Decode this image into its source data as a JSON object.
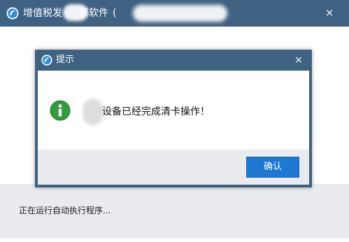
{
  "main_window": {
    "title_part1": "增值税发",
    "title_part2": "票软件",
    "title_part3": "(",
    "close_glyph": "×",
    "status_text": "正在运行自动执行程序...",
    "app_icon": "app-logo-icon"
  },
  "dialog": {
    "title": "提示",
    "close_glyph": "×",
    "message": "设备已经完成清卡操作！",
    "icon": "info-icon",
    "confirm_label": "确认"
  },
  "colors": {
    "titlebar": "#3f6283",
    "button": "#1e78d2",
    "footer": "#e9ebef",
    "info_green": "#2e9d3a"
  }
}
